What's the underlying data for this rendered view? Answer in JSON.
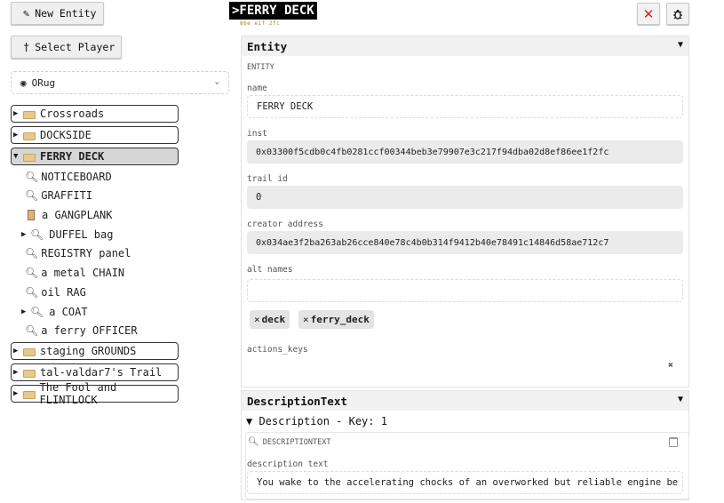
{
  "toolbar": {
    "new_entity_label": "New Entity",
    "select_player_label": "Select Player"
  },
  "player_select": {
    "value": "ORug"
  },
  "tree": {
    "crossroads": "Crossroads",
    "dockside": "DOCKSIDE",
    "ferry_deck": "FERRY DECK",
    "children": {
      "noticeboard": "NOTICEBOARD",
      "graffiti": "GRAFFITI",
      "gangplank": "a GANGPLANK",
      "duffel": "DUFFEL bag",
      "registry": "REGISTRY panel",
      "chain": "a metal CHAIN",
      "rag": "oil RAG",
      "coat": "a COAT",
      "officer": "a ferry OFFICER"
    },
    "staging": "staging GROUNDS",
    "trail": "tal-valdar7's Trail",
    "fool": "The Fool and FLINTLOCK"
  },
  "header": {
    "title": ">FERRY DECK",
    "sub_id": "86e e1f 2fc"
  },
  "entity_panel": {
    "heading": "Entity",
    "section_label": "ENTITY",
    "name_label": "name",
    "name_value": "FERRY DECK",
    "inst_label": "inst",
    "inst_value": "0x03300f5cdb0c4fb0281ccf00344beb3e79907e3c217f94dba02d8ef86ee1f2fc",
    "trail_label": "trail id",
    "trail_value": "0",
    "creator_label": "creator address",
    "creator_value": "0x034ae3f2ba263ab26cce840e78c4b0b314f9412b40e78491c14846d58ae712c7",
    "alt_label": "alt names",
    "alt_value": "",
    "chips": [
      "deck",
      "ferry_deck"
    ],
    "actions_label": "actions_keys"
  },
  "description_panel": {
    "heading": "DescriptionText",
    "subheading": "▼ Description - Key: 1",
    "section_label": "DESCRIPTIONTEXT",
    "desc_label": "description text",
    "desc_value": "You wake to the accelerating chocks of an overworked but reliable engine be"
  },
  "colors": {
    "close": "#d0241b",
    "title_bg": "#000000",
    "folder": "#e8c98c"
  }
}
